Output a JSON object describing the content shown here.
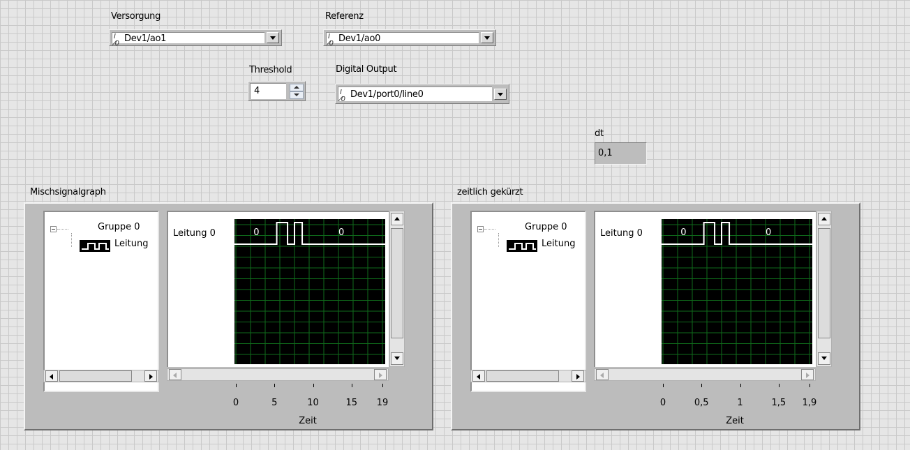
{
  "versorgung": {
    "label": "Versorgung",
    "value": "Dev1/ao1",
    "io_icon": "I/O"
  },
  "referenz": {
    "label": "Referenz",
    "value": "Dev1/ao0",
    "io_icon": "I/O"
  },
  "threshold": {
    "label": "Threshold",
    "value": "4"
  },
  "digital_output": {
    "label": "Digital Output",
    "value": "Dev1/port0/line0",
    "io_icon": "I/O"
  },
  "dt": {
    "label": "dt",
    "value": "0,1"
  },
  "graphs": [
    {
      "title": "Mischsignalgraph",
      "group": "Gruppe 0",
      "signal": "Leitung",
      "plot_label": "Leitung 0",
      "state_labels": [
        "0",
        "0"
      ],
      "x_ticks": [
        "0",
        "5",
        "10",
        "15",
        "19"
      ],
      "x_tick_values": [
        0,
        5,
        10,
        15,
        19
      ],
      "x_range": [
        0,
        19
      ],
      "axis_label": "Zeit",
      "pulses": [
        [
          5.3,
          6.7
        ],
        [
          7.6,
          8.6
        ]
      ]
    },
    {
      "title": "zeitlich gekürzt",
      "group": "Gruppe 0",
      "signal": "Leitung",
      "plot_label": "Leitung 0",
      "state_labels": [
        "0",
        "0"
      ],
      "x_ticks": [
        "0",
        "0,5",
        "1",
        "1,5",
        "1,9"
      ],
      "x_tick_values": [
        0,
        0.5,
        1,
        1.5,
        1.9
      ],
      "x_range": [
        0,
        1.9
      ],
      "axis_label": "Zeit",
      "pulses": [
        [
          0.53,
          0.67
        ],
        [
          0.76,
          0.86
        ]
      ]
    }
  ],
  "colors": {
    "plot_bg": "#000000",
    "grid": "#0f6b1b",
    "trace": "#ffffff"
  }
}
